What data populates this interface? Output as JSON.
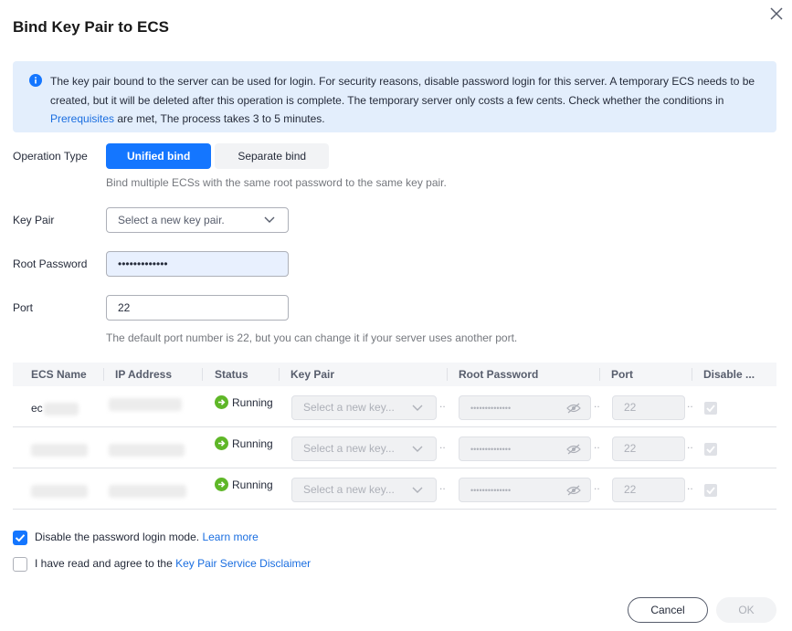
{
  "dialog": {
    "title": "Bind Key Pair to ECS"
  },
  "notice": {
    "text": "The key pair bound to the server can be used for login. For security reasons, disable password login for this server. A temporary ECS needs to be created, but it will be deleted after this operation is complete. The temporary server only costs a few cents. Check whether the conditions in ",
    "link": "Prerequisites",
    "after": " are met, The process takes 3 to 5 minutes."
  },
  "form": {
    "operation_type_label": "Operation Type",
    "operation_options": [
      "Unified bind",
      "Separate bind"
    ],
    "operation_selected": "Unified bind",
    "operation_hint": "Bind multiple ECSs with the same root password to the same key pair.",
    "key_pair_label": "Key Pair",
    "key_pair_placeholder": "Select a new key pair.",
    "root_password_label": "Root Password",
    "root_password_value": "•••••••••••••",
    "port_label": "Port",
    "port_value": "22",
    "port_hint": "The default port number is 22, but you can change it if your server uses another port."
  },
  "table": {
    "columns": [
      "ECS Name",
      "IP Address",
      "Status",
      "Key Pair",
      "Root Password",
      "Port",
      "Disable ..."
    ],
    "rows": [
      {
        "name": "ec",
        "status": "Running",
        "key_pair": "Select a new key...",
        "password": "••••••••••••••",
        "port": "22"
      },
      {
        "name": "",
        "status": "Running",
        "key_pair": "Select a new key...",
        "password": "••••••••••••••",
        "port": "22"
      },
      {
        "name": "",
        "status": "Running",
        "key_pair": "Select a new key...",
        "password": "••••••••••••••",
        "port": "22"
      }
    ]
  },
  "options": {
    "disable_pw_label": "Disable the password login mode. ",
    "learn_more": "Learn more",
    "agree_label": "I have read and agree to the ",
    "disclaimer_link": "Key Pair Service Disclaimer"
  },
  "footer": {
    "cancel": "Cancel",
    "ok": "OK"
  },
  "colors": {
    "accent": "#1476ff",
    "notice_bg": "#e3eefc",
    "success": "#5fb728"
  },
  "icons": [
    "close-icon",
    "info-icon",
    "chevron-down-icon",
    "running-icon",
    "eye-icon",
    "checkmark-icon"
  ]
}
